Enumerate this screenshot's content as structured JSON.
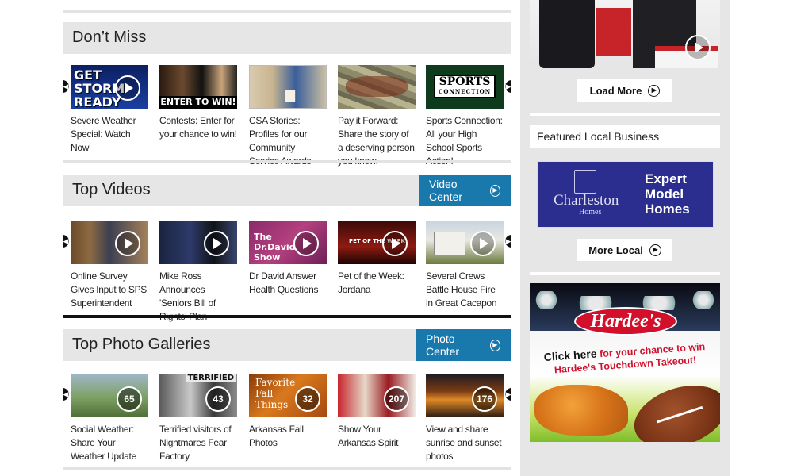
{
  "dont_miss": {
    "title": "Don’t Miss",
    "items": [
      {
        "caption": "Severe Weather Special: Watch Now",
        "thumb_text": "GET STORM READY"
      },
      {
        "caption": "Contests: Enter for your chance to win!",
        "thumb_text": "ENTER TO WIN!"
      },
      {
        "caption": "CSA Stories: Profiles for our Community Service Awards"
      },
      {
        "caption": "Pay it Forward: Share the story of a deserving person you know."
      },
      {
        "caption": "Sports Connection: All your High School Sports Action!",
        "thumb_text": "SPORTS",
        "thumb_sub": "CONNECTION"
      }
    ]
  },
  "top_videos": {
    "title": "Top Videos",
    "button": "Video Center",
    "items": [
      {
        "caption": "Online Survey Gives Input to SPS Superintendent"
      },
      {
        "caption": "Mike Ross Announces 'Seniors Bill of Rights' Plan"
      },
      {
        "caption": "Dr David Answer Health Questions",
        "thumb_text": "The Dr.David Show"
      },
      {
        "caption": "Pet of the Week: Jordana",
        "thumb_text": "PET OF THE WEEK"
      },
      {
        "caption": "Several Crews Battle House Fire in Great Cacapon"
      }
    ]
  },
  "top_photos": {
    "title": "Top Photo Galleries",
    "button": "Photo Center",
    "items": [
      {
        "caption": "Social Weather: Share Your Weather Update",
        "count": "65"
      },
      {
        "caption": "Terrified visitors of Nightmares Fear Factory",
        "count": "43",
        "thumb_text": "TERRIFIED"
      },
      {
        "caption": "Arkansas Fall Photos",
        "count": "32",
        "thumb_text": "Favorite Fall Things"
      },
      {
        "caption": "Show Your Arkansas Spirit",
        "count": "207"
      },
      {
        "caption": "View and share sunrise and sunset photos",
        "count": "176"
      }
    ]
  },
  "sidebar": {
    "load_more": "Load More",
    "featured_title": "Featured Local Business",
    "ad_charleston": {
      "brand": "Charleston",
      "brand_sub": "Homes",
      "tagline_1": "Expert",
      "tagline_2": "Model",
      "tagline_3": "Homes"
    },
    "more_local": "More Local",
    "ad_hardees": {
      "brand": "Hardee's",
      "line_1": "Click here",
      "line_1b": "for your chance to win",
      "line_2": "Hardee's Touchdown Takeout!"
    }
  },
  "colors": {
    "accent_blue": "#1979ad",
    "header_gray": "#e6e6e6",
    "ad_navy": "#2b2d8f",
    "hardees_red": "#d2102b"
  },
  "icons": {
    "play": "play-circle-icon",
    "arrow": "arrow-right-circle-icon",
    "carousel_prev": "chevron-left-icon",
    "carousel_next": "chevron-right-icon"
  }
}
